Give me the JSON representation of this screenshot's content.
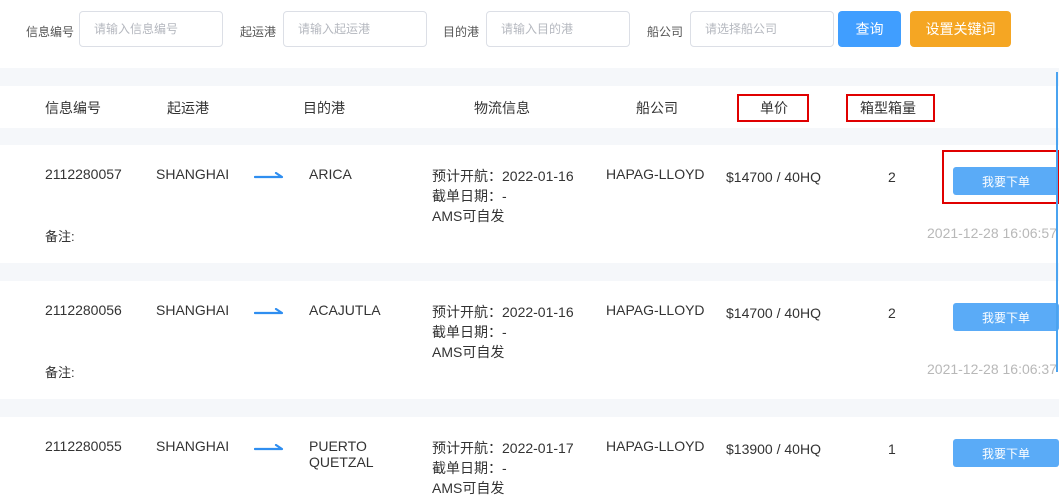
{
  "search": {
    "fields": [
      {
        "label": "信息编号",
        "placeholder": "请输入信息编号"
      },
      {
        "label": "起运港",
        "placeholder": "请输入起运港"
      },
      {
        "label": "目的港",
        "placeholder": "请输入目的港"
      },
      {
        "label": "船公司",
        "placeholder": "请选择船公司"
      }
    ],
    "query_label": "查询",
    "keyword_label": "设置关键词"
  },
  "table": {
    "headers": [
      "信息编号",
      "起运港",
      "目的港",
      "物流信息",
      "船公司",
      "单价",
      "箱型箱量"
    ],
    "remark_label": "备注:",
    "order_label": "我要下单",
    "rows": [
      {
        "id": "2112280057",
        "origin": "SHANGHAI",
        "destination": "ARICA",
        "sailing": "预计开航：2022-01-16",
        "cutoff": "截单日期：-",
        "ams": "AMS可自发",
        "carrier": "HAPAG-LLOYD",
        "price": "$14700 / 40HQ",
        "qty": "2",
        "timestamp": "2021-12-28 16:06:57"
      },
      {
        "id": "2112280056",
        "origin": "SHANGHAI",
        "destination": "ACAJUTLA",
        "sailing": "预计开航：2022-01-16",
        "cutoff": "截单日期：-",
        "ams": "AMS可自发",
        "carrier": "HAPAG-LLOYD",
        "price": "$14700 / 40HQ",
        "qty": "2",
        "timestamp": "2021-12-28 16:06:37"
      },
      {
        "id": "2112280055",
        "origin": "SHANGHAI",
        "destination": "PUERTO QUETZAL",
        "sailing": "预计开航：2022-01-17",
        "cutoff": "截单日期：-",
        "ams": "AMS可自发",
        "carrier": "HAPAG-LLOYD",
        "price": "$13900 / 40HQ",
        "qty": "1",
        "timestamp": ""
      }
    ]
  },
  "colors": {
    "primary": "#409eff",
    "warning": "#f5a623",
    "highlight": "#e00000",
    "order_button": "#5aabf7"
  }
}
